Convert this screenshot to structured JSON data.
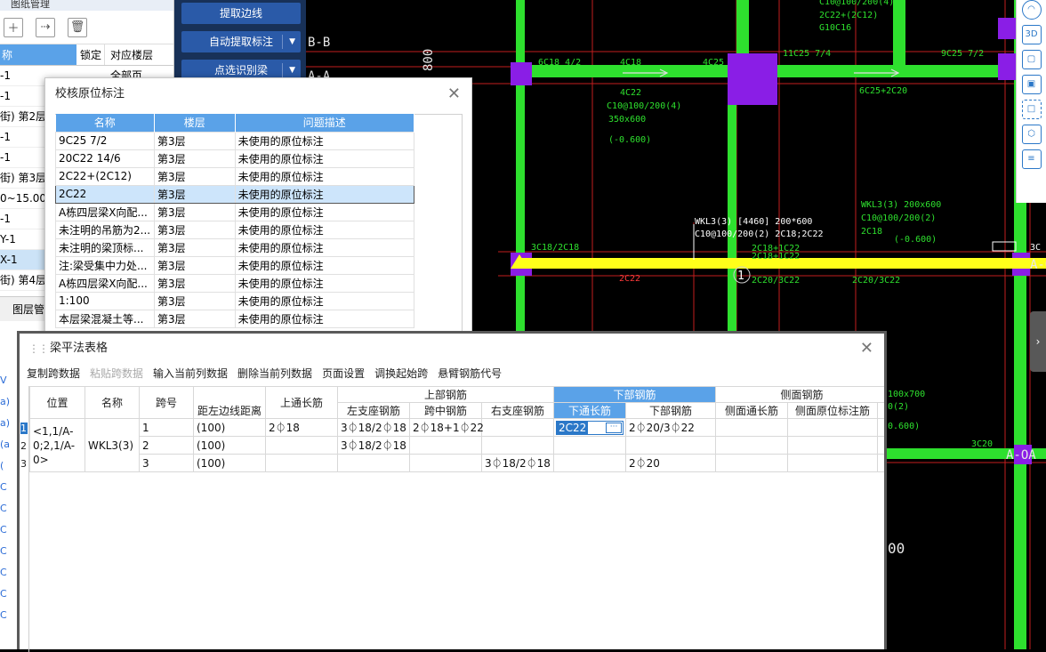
{
  "left_panel": {
    "title": "图纸管理",
    "headers": {
      "name": "称",
      "lock": "锁定",
      "floor": "对应楼层"
    },
    "floor_first_row": "全部页",
    "rows": [
      "-1",
      "-1",
      "街) 第2层",
      "-1",
      "-1",
      "街) 第3层",
      "0~15.000",
      "-1",
      "Y-1",
      "X-1",
      "街) 第4层"
    ],
    "selected_row": 9,
    "tab": "图层管",
    "lower_rows": [
      "V",
      "a)",
      "a)",
      "(a",
      "(",
      "C",
      "C",
      "C",
      "C",
      "C",
      "C",
      "C"
    ]
  },
  "top_buttons": [
    {
      "label": "提取边线",
      "dropdown": false
    },
    {
      "label": "自动提取标注",
      "dropdown": true
    },
    {
      "label": "点选识别梁",
      "dropdown": true
    }
  ],
  "cad": {
    "axis_labels": [
      "B-B",
      "A-A",
      "A-OA",
      "A-OA",
      "1",
      "3C"
    ],
    "dimension": "800",
    "bottom_number": "00",
    "texts": {
      "t_6c18": "6C18 4/2",
      "t_4c18": "4C18",
      "t_4c25": "4C25",
      "t_11c25": "11C25 7/4",
      "t_9c25": "9C25 7/2",
      "t_4c22": "4C22",
      "t_c10": "C10@100/200(4)",
      "t_350": "350x600",
      "t_neg0600": "(-0.600)",
      "t_6c25": "6C25+2C20",
      "t_top1": "C10@100/200(4)",
      "t_top2": "2C22+(2C12)",
      "t_top3": "G10C16",
      "t_wkl_a": "WKL3(3) 200x600",
      "t_wkl_b": "C10@100/200(2)",
      "t_wkl_c": "2C18",
      "t_wkl_d": "(-0.600)",
      "t_wkl_main": "WKL3(3) [4460] 200*600",
      "t_wkl_main2": "C10@100/200(2) 2C18;2C22",
      "t_2c18_1c22": "2C18+1C22",
      "t_2c18r": "2C18+1C22",
      "t_3c18": "3C18/2C18",
      "t_2c22": "2C22",
      "t_2c20_3c22": "2C20/3C22",
      "t_2c20_3c22b": "2C20/3C22",
      "t_3c20": "3C20",
      "t_100x700": "100x700",
      "t_b2": "0(2)",
      "t_0600b": "0.600)"
    }
  },
  "dialog1": {
    "title": "校核原位标注",
    "headers": [
      "名称",
      "楼层",
      "问题描述"
    ],
    "selected_row": 3,
    "rows": [
      [
        "9C25 7/2",
        "第3层",
        "未使用的原位标注"
      ],
      [
        "20C22 14/6",
        "第3层",
        "未使用的原位标注"
      ],
      [
        "2C22+(2C12)",
        "第3层",
        "未使用的原位标注"
      ],
      [
        "2C22",
        "第3层",
        "未使用的原位标注"
      ],
      [
        "A栋四层梁X向配...",
        "第3层",
        "未使用的原位标注"
      ],
      [
        "未注明的吊筋为2...",
        "第3层",
        "未使用的原位标注"
      ],
      [
        "未注明的梁顶标...",
        "第3层",
        "未使用的原位标注"
      ],
      [
        "注:梁受集中力处...",
        "第3层",
        "未使用的原位标注"
      ],
      [
        "A栋四层梁X向配...",
        "第3层",
        "未使用的原位标注"
      ],
      [
        "1:100",
        "第3层",
        "未使用的原位标注"
      ],
      [
        "本层梁混凝土等...",
        "第3层",
        "未使用的原位标注"
      ]
    ]
  },
  "dialog2": {
    "title": "梁平法表格",
    "menu": [
      {
        "label": "复制跨数据",
        "enabled": true
      },
      {
        "label": "粘贴跨数据",
        "enabled": false
      },
      {
        "label": "输入当前列数据",
        "enabled": true
      },
      {
        "label": "删除当前列数据",
        "enabled": true
      },
      {
        "label": "页面设置",
        "enabled": true
      },
      {
        "label": "调换起始跨",
        "enabled": true
      },
      {
        "label": "悬臂钢筋代号",
        "enabled": true
      }
    ],
    "headers": {
      "position": "位置",
      "name": "名称",
      "span": "跨号",
      "dist": "距左边线距离",
      "top_long": "上通长筋",
      "top_group": "上部钢筋",
      "left_seat": "左支座钢筋",
      "mid": "跨中钢筋",
      "right_seat": "右支座钢筋",
      "bottom_group": "下部钢筋",
      "bottom_long": "下通长筋",
      "bottom_bar": "下部钢筋",
      "side_group": "侧面钢筋",
      "side_long": "侧面通长筋",
      "side_orig": "侧面原位标注筋"
    },
    "row_numbers": [
      "1",
      "2",
      "3"
    ],
    "position_value": "<1,1/A-0;2,1/A-0>",
    "name_value": "WKL3(3)",
    "rows": [
      {
        "span": "1",
        "dist": "(100)",
        "top_long": "2⏀18",
        "left_seat": "3⏀18/2⏀18",
        "mid": "2⏀18+1⏀22",
        "right_seat": "",
        "bottom_long": "2C22",
        "bottom_bar": "2⏀20/3⏀22",
        "side_long": "",
        "side_orig": ""
      },
      {
        "span": "2",
        "dist": "(100)",
        "top_long": "",
        "left_seat": "3⏀18/2⏀18",
        "mid": "",
        "right_seat": "",
        "bottom_long": "",
        "bottom_bar": "",
        "side_long": "",
        "side_orig": ""
      },
      {
        "span": "3",
        "dist": "(100)",
        "top_long": "",
        "left_seat": "",
        "mid": "",
        "right_seat": "3⏀18/2⏀18",
        "bottom_long": "",
        "bottom_bar": "2⏀20",
        "side_long": "",
        "side_orig": ""
      }
    ]
  }
}
